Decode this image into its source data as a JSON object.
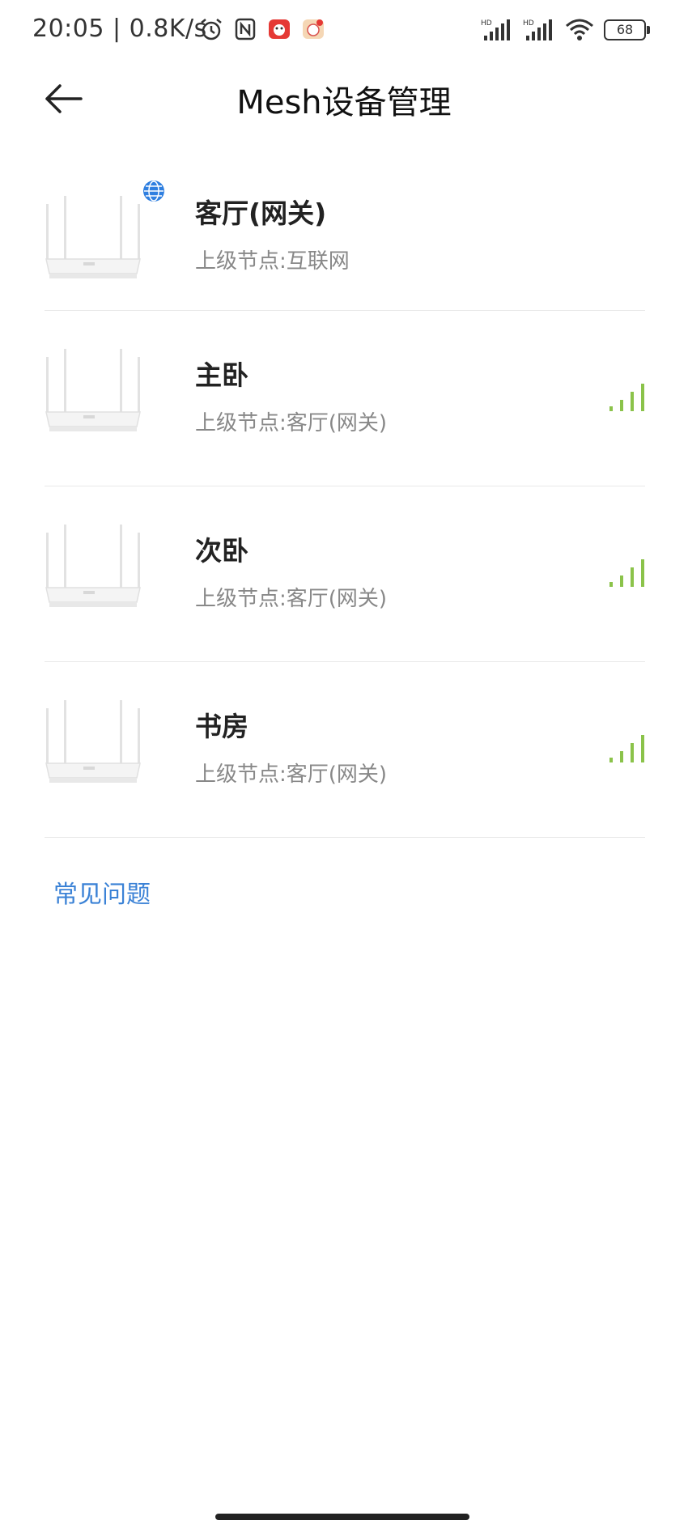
{
  "status_bar": {
    "time_speed": "20:05 | 0.8K/s",
    "battery": "68",
    "hd1": "HD",
    "hd2": "HD"
  },
  "header": {
    "title": "Mesh设备管理",
    "back_icon": "arrow-left-icon"
  },
  "devices": [
    {
      "name": "客厅(网关)",
      "parent": "上级节点:互联网",
      "is_gateway": true
    },
    {
      "name": "主卧",
      "parent": "上级节点:客厅(网关)",
      "is_gateway": false
    },
    {
      "name": "次卧",
      "parent": "上级节点:客厅(网关)",
      "is_gateway": false
    },
    {
      "name": "书房",
      "parent": "上级节点:客厅(网关)",
      "is_gateway": false
    }
  ],
  "faq_label": "常见问题",
  "colors": {
    "accent": "#3b82d6",
    "signal": "#8bc34a",
    "globe": "#2f7fe0"
  }
}
